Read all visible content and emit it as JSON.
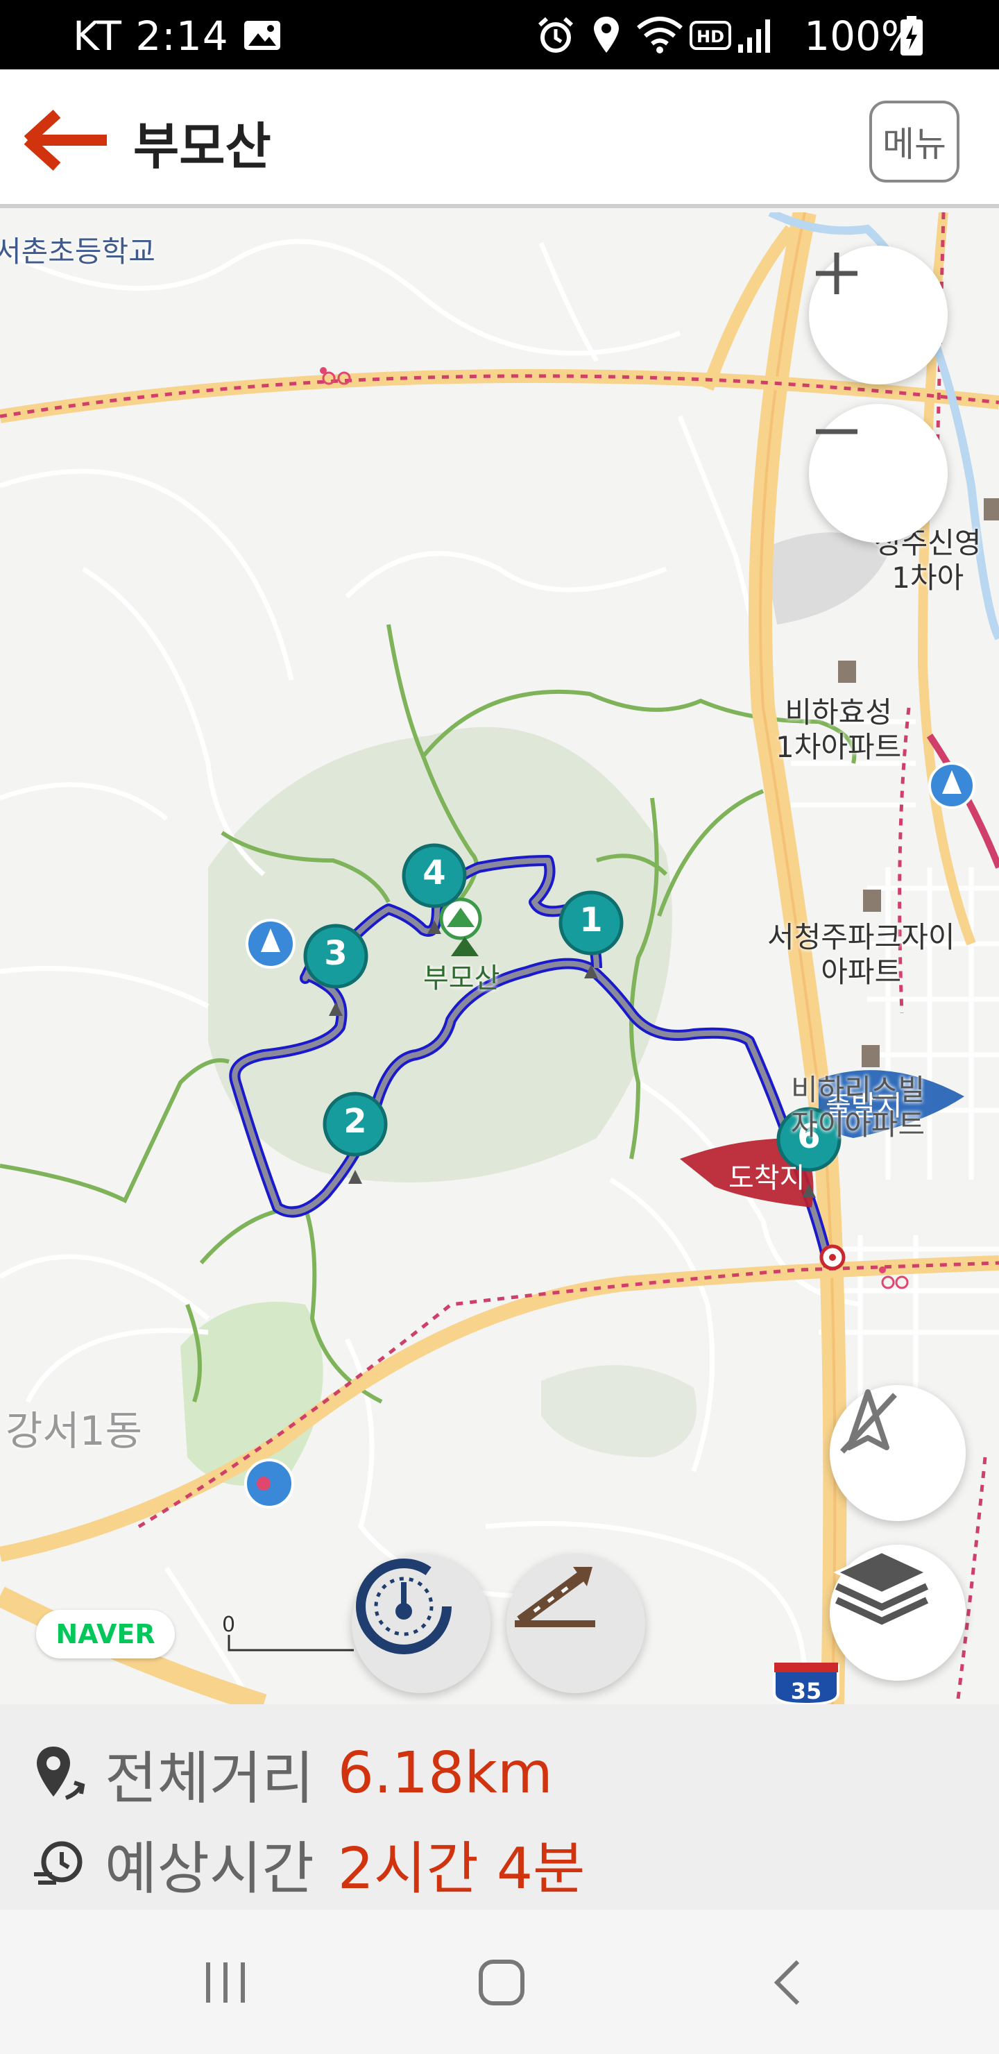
{
  "status_bar": {
    "carrier_time": "KT 2:14",
    "battery": "100%",
    "icons": [
      "image-icon",
      "alarm-icon",
      "location-icon",
      "wifi-icon",
      "hd-icon",
      "signal-icon",
      "battery-icon"
    ]
  },
  "header": {
    "title": "부모산",
    "menu_label": "메뉴",
    "back_icon": "arrow-left-icon"
  },
  "map": {
    "labels": {
      "school": "서촌초등학교",
      "apt1_line1": "정주신영",
      "apt1_line2": "1차아",
      "apt2_line1": "비하효성",
      "apt2_line2": "1차아파트",
      "apt3_line1": "서청주파크자이",
      "apt3_line2": "아파트",
      "apt4_line1": "비하리스빌",
      "apt4_line2": "자이아파트",
      "mountain": "부모산",
      "district": "강서1동",
      "highway_shield": "35"
    },
    "waypoints": [
      "1",
      "2",
      "3",
      "4",
      "6"
    ],
    "flags": {
      "start": "출발지",
      "end": "도착지"
    },
    "scale_zero": "0",
    "provider": "NAVER",
    "controls": [
      "zoom-in-icon",
      "zoom-out-icon",
      "compass-off-icon",
      "layers-icon",
      "speedometer-icon",
      "elevation-icon"
    ]
  },
  "route_info": {
    "distance_label": "전체거리",
    "distance_value": "6.18km",
    "time_label": "예상시간",
    "time_value": "2시간 4분"
  },
  "colors": {
    "accent": "#d0330e",
    "route": "#1a1acc",
    "marker": "#169c9c",
    "road_major": "#f7d38c",
    "trail": "#7eb35a"
  }
}
